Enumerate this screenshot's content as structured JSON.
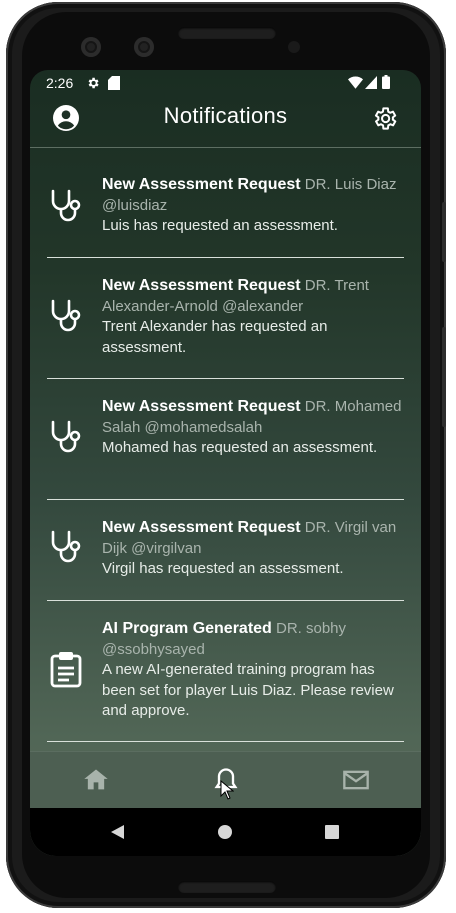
{
  "status_bar": {
    "time": "2:26",
    "left_icons": [
      "gear-icon",
      "sd-card-icon"
    ],
    "right_icons": [
      "wifi-icon",
      "signal-icon",
      "battery-icon"
    ]
  },
  "app_bar": {
    "title": "Notifications",
    "left_icon": "account-circle-icon",
    "right_icon": "settings-icon"
  },
  "notifications": [
    {
      "icon": "stethoscope-icon",
      "title": "New Assessment Request",
      "sender": "DR. Luis Diaz @luisdiaz",
      "body": "Luis has requested an assessment."
    },
    {
      "icon": "stethoscope-icon",
      "title": "New Assessment Request",
      "sender": "DR. Trent Alexander-Arnold @alexander",
      "body": "Trent Alexander has requested an assessment."
    },
    {
      "icon": "stethoscope-icon",
      "title": "New Assessment Request",
      "sender": "DR. Mohamed Salah @mohamedsalah",
      "body": "Mohamed has requested an assessment."
    },
    {
      "icon": "stethoscope-icon",
      "title": "New Assessment Request",
      "sender": "DR. Virgil van Dijk @virgilvan",
      "body": "Virgil has requested an assessment."
    },
    {
      "icon": "clipboard-icon",
      "title": "AI Program Generated",
      "sender": "DR. sobhy @ssobhysayed",
      "body": "A new AI-generated training program has been set for player Luis Diaz. Please review and approve."
    }
  ],
  "bottom_nav": [
    {
      "icon": "home-icon",
      "active": false
    },
    {
      "icon": "bell-icon",
      "active": true
    },
    {
      "icon": "mail-icon",
      "active": false
    }
  ],
  "system_nav": [
    "back-icon",
    "home-circle-icon",
    "recents-icon"
  ],
  "colors": {
    "background_top": "#1a2d22",
    "background_bottom": "#56695b",
    "divider": "#d9e0da",
    "sender_text": "#a9b4ad",
    "bottom_nav_bg": "#4d5f52"
  }
}
